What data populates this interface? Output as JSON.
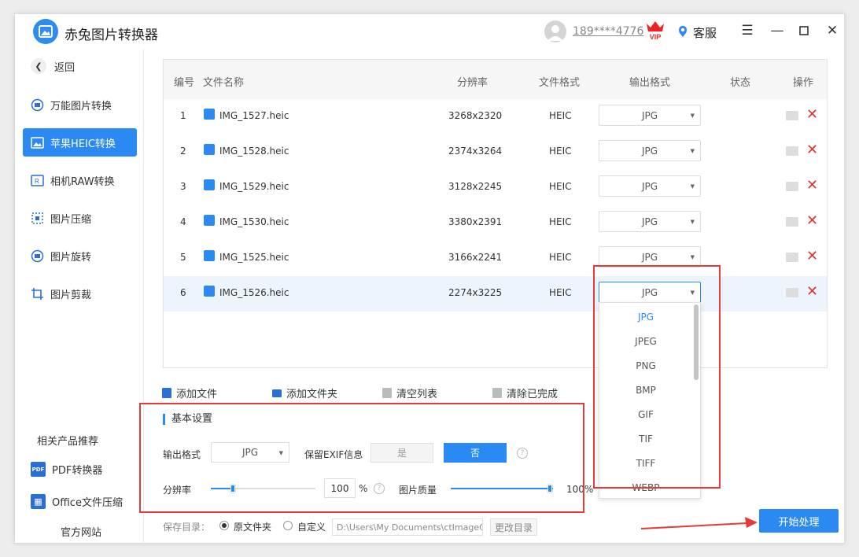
{
  "app": {
    "title": "赤兔图片转换器",
    "user": "189****4776",
    "kefu": "客服"
  },
  "sidebar": {
    "back": "返回",
    "items": [
      {
        "label": "万能图片转换",
        "active": false
      },
      {
        "label": "苹果HEIC转换",
        "active": true
      },
      {
        "label": "相机RAW转换",
        "active": false
      },
      {
        "label": "图片压缩",
        "active": false
      },
      {
        "label": "图片旋转",
        "active": false
      },
      {
        "label": "图片剪裁",
        "active": false
      }
    ],
    "recommend_title": "相关产品推荐",
    "recommend": [
      {
        "label": "PDF转换器",
        "badge": "PDF"
      },
      {
        "label": "Office文件压缩",
        "badge": "▦"
      }
    ],
    "official": "官方网站"
  },
  "table": {
    "headers": [
      "编号",
      "文件名称",
      "分辨率",
      "文件格式",
      "输出格式",
      "状态",
      "操作"
    ],
    "rows": [
      {
        "no": "1",
        "name": "IMG_1527.heic",
        "res": "3268x2320",
        "fmt": "HEIC",
        "out": "JPG"
      },
      {
        "no": "2",
        "name": "IMG_1528.heic",
        "res": "2374x3264",
        "fmt": "HEIC",
        "out": "JPG"
      },
      {
        "no": "3",
        "name": "IMG_1529.heic",
        "res": "3128x2245",
        "fmt": "HEIC",
        "out": "JPG"
      },
      {
        "no": "4",
        "name": "IMG_1530.heic",
        "res": "3380x2391",
        "fmt": "HEIC",
        "out": "JPG"
      },
      {
        "no": "5",
        "name": "IMG_1525.heic",
        "res": "3166x2241",
        "fmt": "HEIC",
        "out": "JPG"
      },
      {
        "no": "6",
        "name": "IMG_1526.heic",
        "res": "2274x3225",
        "fmt": "HEIC",
        "out": "JPG"
      }
    ],
    "dropdown_options": [
      "JPG",
      "JPEG",
      "PNG",
      "BMP",
      "GIF",
      "TIF",
      "TIFF",
      "WEBP"
    ]
  },
  "toolbar": {
    "add_file": "添加文件",
    "add_folder": "添加文件夹",
    "clear": "清空列表",
    "clear_done": "清除已完成"
  },
  "settings": {
    "title": "基本设置",
    "output_label": "输出格式",
    "output_value": "JPG",
    "exif_label": "保留EXIF信息",
    "yes": "是",
    "no": "否",
    "res_label": "分辨率",
    "res_value": "100",
    "percent": "%",
    "quality_label": "图片质量",
    "quality_value": "100%"
  },
  "footer": {
    "save_label": "保存目录：",
    "opt_original": "原文件夹",
    "opt_custom": "自定义",
    "path": "D:\\Users\\My Documents\\ctImageC",
    "change": "更改目录",
    "start": "开始处理"
  },
  "colors": {
    "accent": "#2a89f2",
    "annotation": "#e33b3b"
  }
}
